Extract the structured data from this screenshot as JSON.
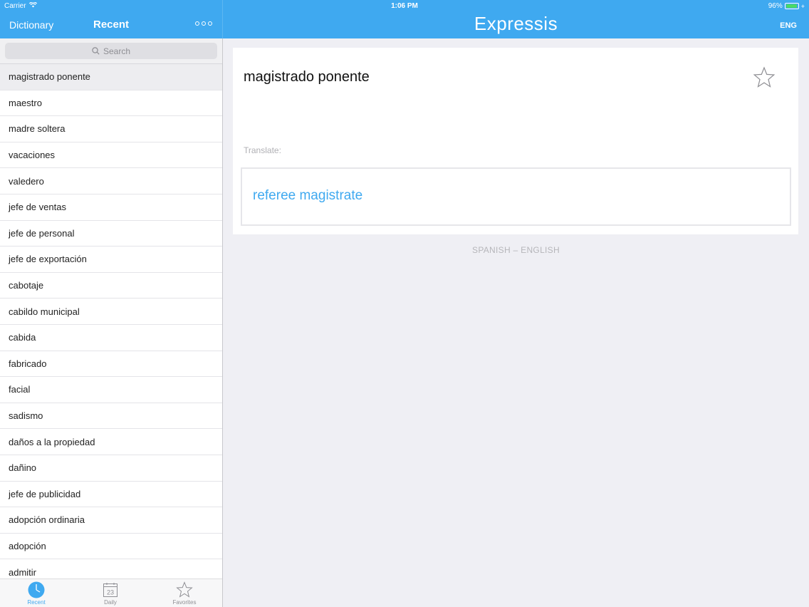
{
  "status_bar": {
    "carrier": "Carrier",
    "time": "1:06 PM",
    "battery_percent": "96%",
    "battery_level": 0.96
  },
  "left_nav": {
    "dictionary_label": "Dictionary",
    "title": "Recent",
    "more_icon": "more-icon"
  },
  "header": {
    "app_title": "Expressis",
    "language_button": "ENG"
  },
  "search": {
    "placeholder": "Search"
  },
  "recent_list": [
    "magistrado ponente",
    "maestro",
    "madre soltera",
    "vacaciones",
    "valedero",
    "jefe de ventas",
    "jefe de personal",
    "jefe de exportación",
    "cabotaje",
    "cabildo municipal",
    "cabida",
    "fabricado",
    "facial",
    "sadismo",
    "daños a la propiedad",
    "dañino",
    "jefe de publicidad",
    "adopción ordinaria",
    "adopción",
    "admitir"
  ],
  "selected_index": 0,
  "tabbar": {
    "tabs": [
      {
        "label": "Recent",
        "icon": "clock-icon",
        "active": true
      },
      {
        "label": "Daily",
        "icon": "calendar-icon",
        "active": false,
        "badge": "23"
      },
      {
        "label": "Favorites",
        "icon": "star-icon",
        "active": false
      }
    ]
  },
  "detail": {
    "word": "magistrado ponente",
    "translate_label": "Translate:",
    "translation": "referee magistrate",
    "language_pair": "SPANISH – ENGLISH"
  },
  "colors": {
    "accent": "#3fa9f0",
    "background": "#efeff4"
  }
}
